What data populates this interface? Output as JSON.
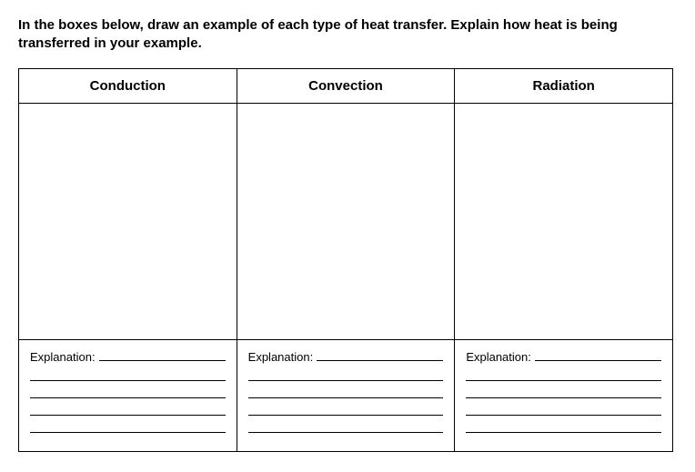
{
  "instructions": "In the boxes below, draw an example of each type of heat transfer. Explain how heat is being transferred in your example.",
  "columns": [
    {
      "header": "Conduction",
      "explanation_label": "Explanation:"
    },
    {
      "header": "Convection",
      "explanation_label": "Explanation:"
    },
    {
      "header": "Radiation",
      "explanation_label": "Explanation:"
    }
  ]
}
